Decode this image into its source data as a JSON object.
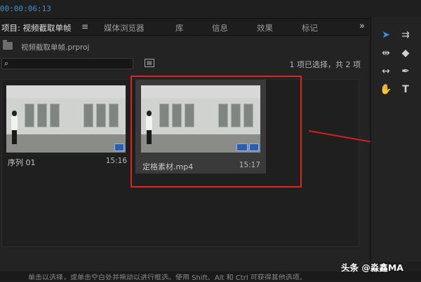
{
  "timecode": "00:00:06:13",
  "tabs": [
    {
      "label": "项目: 视频截取单帧",
      "active": true
    },
    {
      "label": "媒体浏览器",
      "active": false
    },
    {
      "label": "库",
      "active": false
    },
    {
      "label": "信息",
      "active": false
    },
    {
      "label": "效果",
      "active": false
    },
    {
      "label": "标记",
      "active": false
    }
  ],
  "tab_menu_glyph": "≡",
  "overflow_glyph": "»",
  "project_file": "视频截取单帧.prproj",
  "selection_status": "1 项已选择，共 2 项",
  "items": [
    {
      "name": "序列 01",
      "duration": "15:16",
      "selected": false
    },
    {
      "name": "定格素材.mp4",
      "duration": "15:17",
      "selected": true
    }
  ],
  "watermark": "头条 @淼鑫MA",
  "caption_fragment": "单击以选择，或单击空白处并拖动以进行框选。使用 Shift、Alt 和 Ctrl 可获得其他选项。",
  "colors": {
    "accent": "#3b8ee8",
    "highlight": "#e02424"
  },
  "icons": {
    "tools": [
      "selection-arrow-icon",
      "track-select-icon",
      "ripple-edit-icon",
      "razor-icon",
      "slip-icon",
      "pen-icon",
      "hand-icon",
      "type-icon"
    ],
    "bottom": [
      "lock-icon",
      "list-view-icon",
      "icon-view-icon",
      "zoom-slider",
      "sort-icon",
      "automate-icon",
      "find-icon",
      "new-bin-icon",
      "new-item-icon",
      "trash-icon"
    ]
  }
}
